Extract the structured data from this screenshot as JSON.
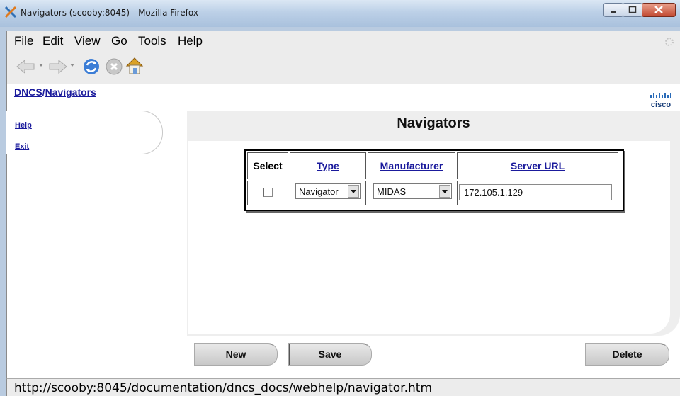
{
  "window": {
    "title": "Navigators (scooby:8045) - Mozilla Firefox"
  },
  "menu": {
    "items": [
      "File",
      "Edit",
      "View",
      "Go",
      "Tools",
      "Help"
    ]
  },
  "breadcrumb": {
    "root": "DNCS",
    "separator": "/",
    "current": "Navigators"
  },
  "sidebar": {
    "help": "Help",
    "exit": "Exit"
  },
  "panel": {
    "title": "Navigators"
  },
  "table": {
    "headers": {
      "select": "Select",
      "type": "Type",
      "manufacturer": "Manufacturer",
      "server_url": "Server URL"
    },
    "row": {
      "selected": false,
      "type": "Navigator",
      "manufacturer": "MIDAS",
      "server_url": "172.105.1.129"
    }
  },
  "buttons": {
    "new": "New",
    "save": "Save",
    "delete": "Delete"
  },
  "status_bar": {
    "text": "http://scooby:8045/documentation/dncs_docs/webhelp/navigator.htm"
  },
  "icons": [
    "firefox-icon",
    "minimize-icon",
    "maximize-icon",
    "close-icon",
    "throbber-icon",
    "back-icon",
    "forward-icon",
    "reload-icon",
    "stop-icon",
    "home-icon",
    "cisco-logo"
  ]
}
